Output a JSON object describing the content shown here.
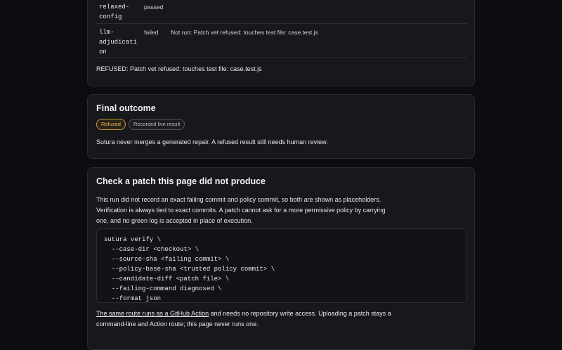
{
  "checks": {
    "rows": [
      {
        "name": "relaxed-\nconfig",
        "status": "passed",
        "detail": ""
      },
      {
        "name": "llm-\nadjudicati\non",
        "status": "failed",
        "detail": "Not run: Patch vet refused: touches test file: case.test.js"
      }
    ],
    "note": "REFUSED: Patch vet refused: touches test file: case.test.js"
  },
  "outcome": {
    "title": "Final outcome",
    "badges": [
      "Refused",
      "Recorded live result"
    ],
    "text": "Sutura never merges a generated repair. A refused result still needs human review."
  },
  "verify": {
    "title": "Check a patch this page did not produce",
    "para": "This run did not record an exact failing commit and policy commit, so both are shown as placeholders. Verification is always tied to exact commits. A patch cannot ask for a more permissive policy by carrying one, and no green log is accepted in place of execution.",
    "code": [
      "sutura verify \\",
      "  --case-dir <checkout> \\",
      "  --source-sha <failing commit> \\",
      "  --policy-base-sha <trusted policy commit> \\",
      "  --candidate-diff <patch file> \\",
      "  --failing-command diagnosed \\",
      "  --format json"
    ],
    "footer_link": "The same route runs as a GitHub Action",
    "footer_rest": " and needs no repository write access. Uploading a patch stays a command-line and Action route; this page never runs one."
  },
  "colors": {
    "background": "#0c0d10",
    "card": "#17181c",
    "refused_accent": "#e0b660"
  }
}
